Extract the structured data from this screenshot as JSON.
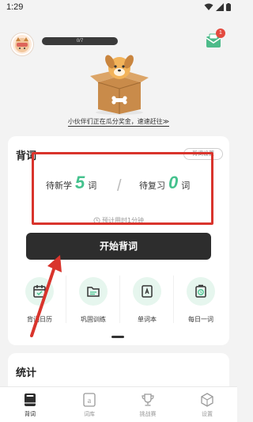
{
  "status_bar": {
    "time": "1:29"
  },
  "header": {
    "progress_text": "0/7",
    "mail_badge": "1",
    "promo_text": "小伙伴们正在瓜分奖金，速速赶往≫"
  },
  "study_card": {
    "title": "背词",
    "settings_label": "背词设置",
    "new_label": "待新学",
    "new_count": "5",
    "review_label": "待复习",
    "review_count": "0",
    "unit": "词",
    "divider": "/",
    "eta": "预计用时1分钟",
    "start_button": "开始背词",
    "accent_color": "#45c28e"
  },
  "features": [
    {
      "label": "背词日历",
      "icon": "calendar-icon"
    },
    {
      "label": "巩固训练",
      "icon": "folder-icon"
    },
    {
      "label": "单词本",
      "icon": "book-icon"
    },
    {
      "label": "每日一词",
      "icon": "daily-icon"
    }
  ],
  "stats": {
    "title": "统计"
  },
  "tabs": [
    {
      "label": "背词",
      "icon": "book-tab-icon",
      "active": true
    },
    {
      "label": "词库",
      "icon": "library-icon",
      "active": false
    },
    {
      "label": "挑战赛",
      "icon": "trophy-icon",
      "active": false
    },
    {
      "label": "设置",
      "icon": "settings-icon",
      "active": false
    }
  ]
}
